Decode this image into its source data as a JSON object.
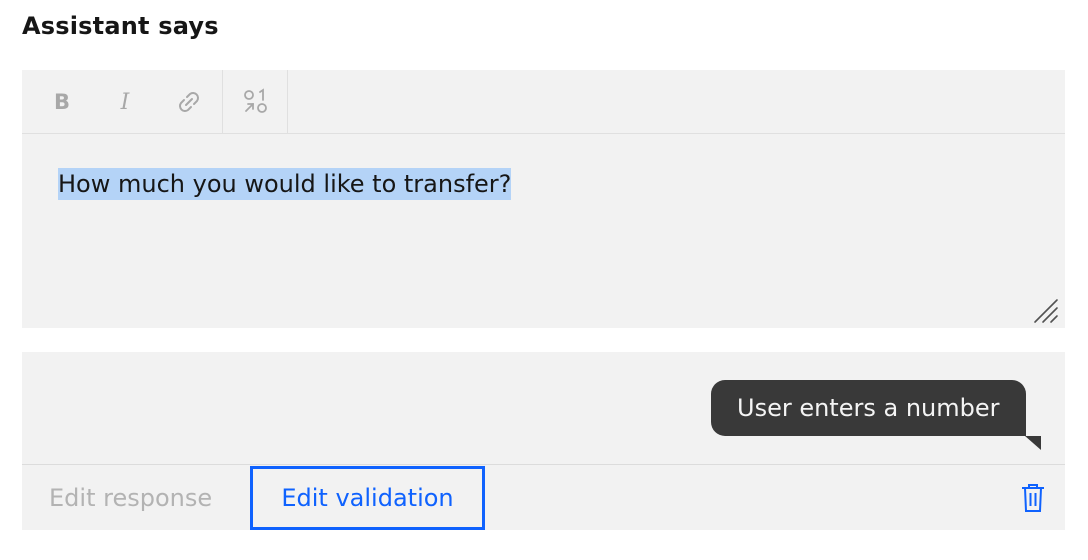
{
  "heading": "Assistant says",
  "toolbar": {
    "bold": {
      "label": "B",
      "icon": "bold-icon"
    },
    "italic": {
      "label": "I",
      "icon": "italic-icon"
    },
    "link": {
      "icon": "link-icon"
    },
    "variables": {
      "icon": "insert-variable-icon"
    }
  },
  "editor": {
    "text": "How much you would like to transfer?",
    "selection_color": "#b4d3f7"
  },
  "response": {
    "tooltip_text": "User enters a number",
    "tabs": [
      {
        "label": "Edit response",
        "active": false
      },
      {
        "label": "Edit validation",
        "active": true
      }
    ],
    "delete_icon": "trash-icon"
  },
  "colors": {
    "accent": "#0f62fe",
    "panel": "#f2f2f2",
    "tooltip_bg": "#393939",
    "disabled_text": "#b3b3b3"
  }
}
